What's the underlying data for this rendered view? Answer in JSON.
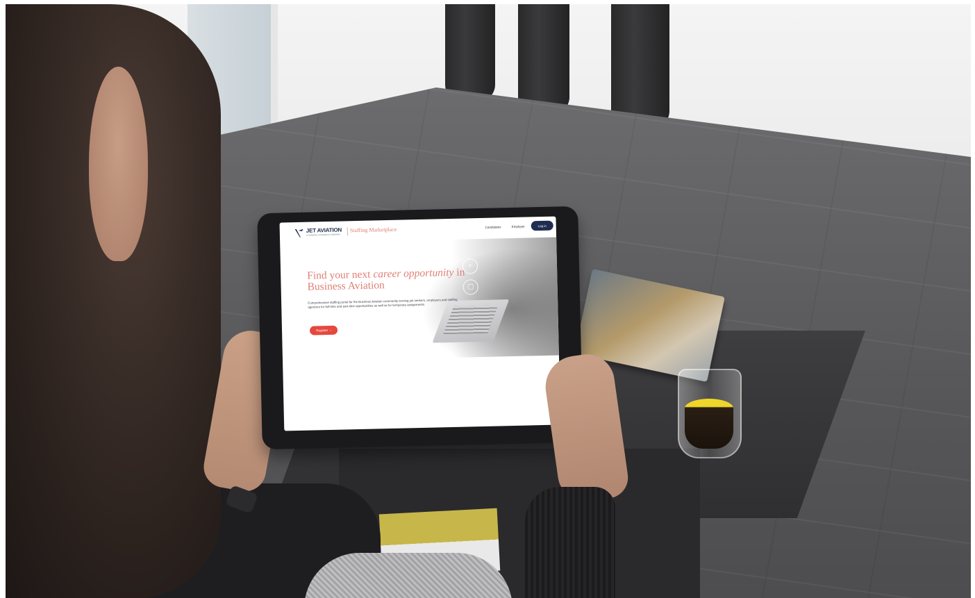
{
  "scene": {
    "description_tags": [
      "photo",
      "person-holding-tablet",
      "coffee-table",
      "espresso-glass",
      "magazine"
    ]
  },
  "tablet_page": {
    "brand": {
      "logo_text": "JET AVIATION",
      "logo_tagline": "A GENERAL DYNAMICS COMPANY",
      "product_name": "Staffing Marketplace"
    },
    "nav": {
      "link_candidates": "Candidates",
      "link_employers": "Employer",
      "login_label": "Log in"
    },
    "hero": {
      "headline_part1": "Find your next ",
      "headline_italic": "career opportunity",
      "headline_part2": " in Business Aviation",
      "intro_text": "Comprehensive staffing portal for the Business Aviation community serving job seekers, employers and staffing agencies for full-time and part-time opportunities as well as for temporary assignments.",
      "register_label": "Register",
      "register_arrow": "›"
    },
    "colors": {
      "accent_coral": "#e07f74",
      "button_red": "#e5483d",
      "navy": "#1f2d52"
    }
  }
}
